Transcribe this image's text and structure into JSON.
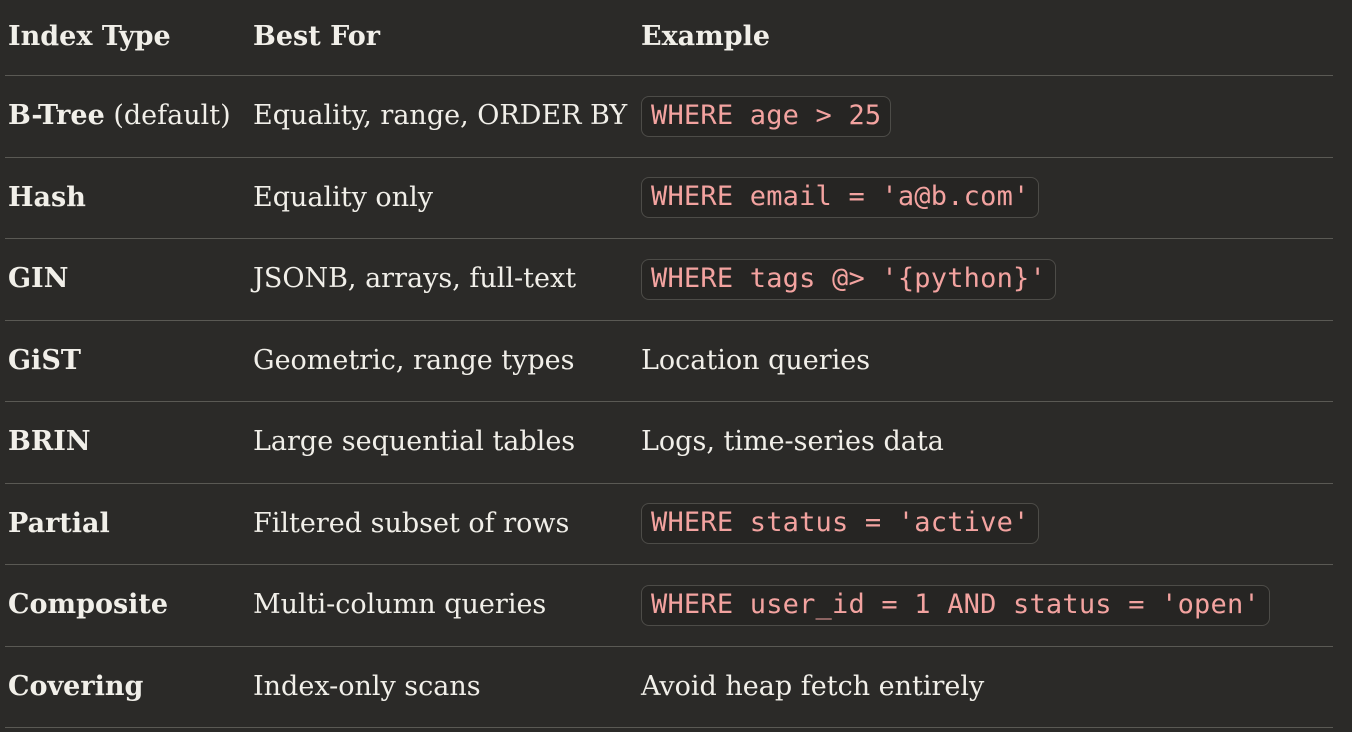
{
  "table": {
    "headers": [
      "Index Type",
      "Best For",
      "Example"
    ],
    "rows": [
      {
        "name": "B-Tree",
        "note": " (default)",
        "best_for": "Equality, range, ORDER BY",
        "example": "WHERE age > 25",
        "example_is_code": true
      },
      {
        "name": "Hash",
        "note": "",
        "best_for": "Equality only",
        "example": "WHERE email = 'a@b.com'",
        "example_is_code": true
      },
      {
        "name": "GIN",
        "note": "",
        "best_for": "JSONB, arrays, full-text",
        "example": "WHERE tags @> '{python}'",
        "example_is_code": true
      },
      {
        "name": "GiST",
        "note": "",
        "best_for": "Geometric, range types",
        "example": "Location queries",
        "example_is_code": false
      },
      {
        "name": "BRIN",
        "note": "",
        "best_for": "Large sequential tables",
        "example": "Logs, time-series data",
        "example_is_code": false
      },
      {
        "name": "Partial",
        "note": "",
        "best_for": "Filtered subset of rows",
        "example": "WHERE status = 'active'",
        "example_is_code": true
      },
      {
        "name": "Composite",
        "note": "",
        "best_for": "Multi-column queries",
        "example": "WHERE user_id = 1 AND status = 'open'",
        "example_is_code": true
      },
      {
        "name": "Covering",
        "note": "",
        "best_for": "Index-only scans",
        "example": "Avoid heap fetch entirely",
        "example_is_code": false
      }
    ]
  }
}
